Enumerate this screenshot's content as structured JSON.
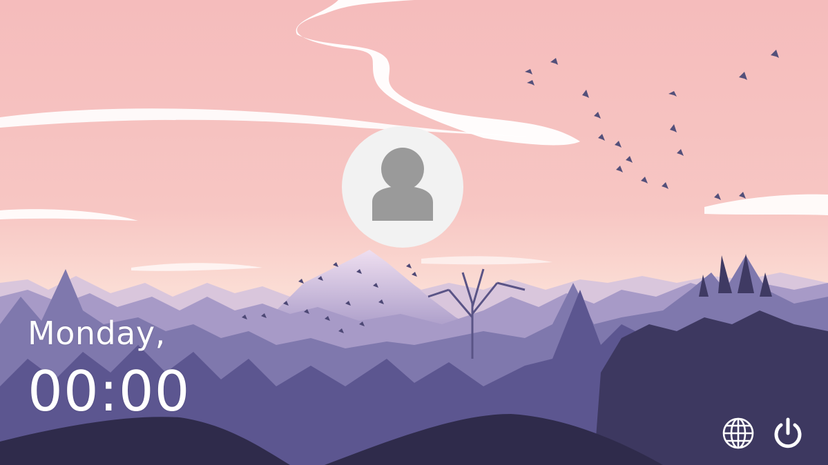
{
  "lock_screen": {
    "day": "Monday,",
    "time": "00:00"
  },
  "user": {
    "avatar_icon": "user-icon"
  },
  "system_tray": {
    "language_icon": "globe-icon",
    "power_icon": "power-icon"
  },
  "colors": {
    "sky_top": "#f6bfbe",
    "sky_horizon": "#fbe0d8",
    "far_mountains": "#b9a7cf",
    "mid_mountains": "#8f87b8",
    "near_forest": "#5e5990",
    "foreground": "#2e2a48",
    "avatar_bg": "#f2f2f2",
    "avatar_fg": "#9a9a9a",
    "text": "#ffffff"
  }
}
